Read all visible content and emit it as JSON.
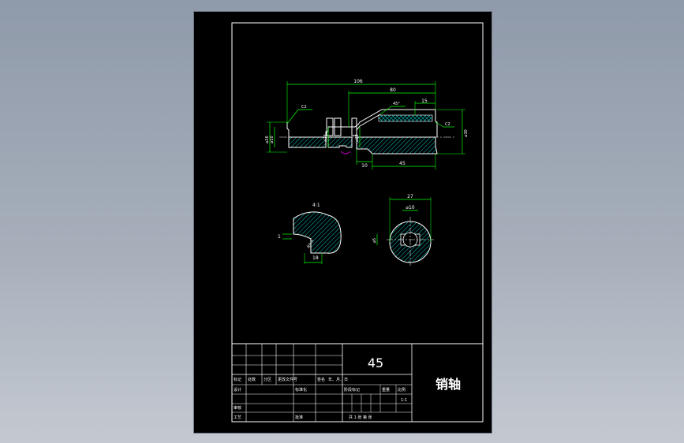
{
  "drawing": {
    "part_name": "销轴",
    "material": "45",
    "scale": "1:1",
    "sheet_info": "共 1 张  第 张"
  },
  "main_view": {
    "dim_overall": "106",
    "dim_80": "80",
    "dim_15": "15",
    "dim_10": "10",
    "dim_45": "45",
    "chamfer_c": "45°",
    "note_c1": "C2",
    "note_c2": "C2",
    "dia_26": "⌀26",
    "dia_10": "⌀10",
    "dia_23": "⌀23",
    "dia_20": "⌀20",
    "dia_30": "⌀30"
  },
  "detail_view": {
    "label": "4:1",
    "dim_1": "1",
    "dim_18": "18",
    "dim_r": "R0.5"
  },
  "section_view": {
    "dim_27": "27",
    "dim_10": "⌀10",
    "dim_5": "⌀5"
  },
  "title_block": {
    "row_labels": [
      "标记",
      "处数",
      "分区",
      "更改文件号",
      "签名",
      "年、月、日"
    ],
    "design": "设计",
    "std": "标准化",
    "review": "审核",
    "process": "工艺",
    "approve": "批准",
    "stage_mark": "阶段标记",
    "weight": "重量",
    "ratio": "比例"
  },
  "colors": {
    "frame": "#ffffff",
    "dimension": "#00ff00",
    "hatch": "#00c8c8",
    "section_cut": "#b000b0",
    "text_white": "#ffffff"
  }
}
